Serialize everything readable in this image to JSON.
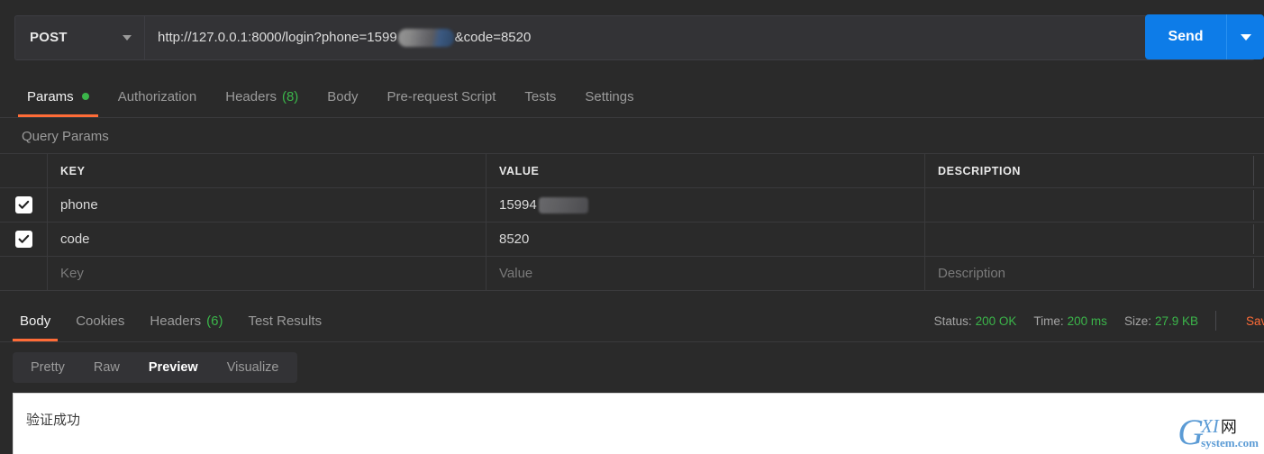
{
  "request": {
    "method": "POST",
    "url_prefix": "http://127.0.0.1:8000/login?phone=1599",
    "url_suffix": "&code=8520",
    "send_label": "Send",
    "tabs": [
      {
        "label": "Params",
        "active": true,
        "dot": true
      },
      {
        "label": "Authorization",
        "active": false
      },
      {
        "label": "Headers",
        "count": "(8)",
        "active": false
      },
      {
        "label": "Body",
        "active": false
      },
      {
        "label": "Pre-request Script",
        "active": false
      },
      {
        "label": "Tests",
        "active": false
      },
      {
        "label": "Settings",
        "active": false
      }
    ]
  },
  "params": {
    "section_title": "Query Params",
    "headers": {
      "key": "KEY",
      "value": "VALUE",
      "description": "DESCRIPTION"
    },
    "rows": [
      {
        "checked": true,
        "key": "phone",
        "value": "15994",
        "value_redacted": true,
        "description": ""
      },
      {
        "checked": true,
        "key": "code",
        "value": "8520",
        "value_redacted": false,
        "description": ""
      }
    ],
    "placeholder_row": {
      "key": "Key",
      "value": "Value",
      "description": "Description"
    }
  },
  "response": {
    "tabs": [
      {
        "label": "Body",
        "active": true
      },
      {
        "label": "Cookies",
        "active": false
      },
      {
        "label": "Headers",
        "count": "(6)",
        "active": false
      },
      {
        "label": "Test Results",
        "active": false
      }
    ],
    "status_label": "Status:",
    "status_value": "200 OK",
    "time_label": "Time:",
    "time_value": "200 ms",
    "size_label": "Size:",
    "size_value": "27.9 KB",
    "save_label": "Sav",
    "view_modes": [
      {
        "label": "Pretty",
        "active": false
      },
      {
        "label": "Raw",
        "active": false
      },
      {
        "label": "Preview",
        "active": true
      },
      {
        "label": "Visualize",
        "active": false
      }
    ],
    "body_text": "验证成功"
  },
  "watermark": {
    "g": "G",
    "xi": "XI",
    "cn": "网",
    "domain": "system.com"
  },
  "colors": {
    "accent_orange": "#ff6c37",
    "send_blue": "#0d7ce8",
    "success_green": "#3bb54a",
    "background": "#2a2a2a"
  }
}
